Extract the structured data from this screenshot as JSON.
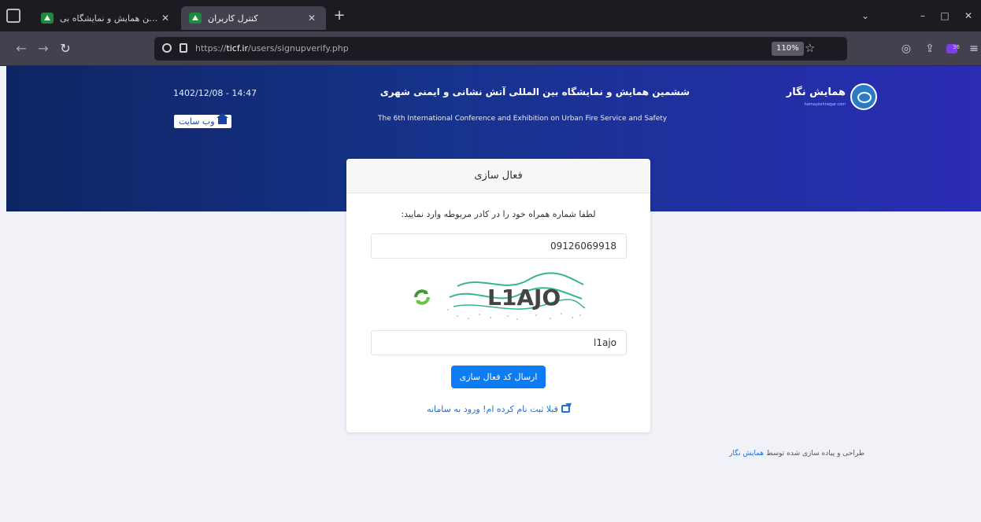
{
  "browser": {
    "tabs": [
      {
        "title": "ششمین همایش و نمایشگاه بی",
        "active": false
      },
      {
        "title": "کنترل کاربران",
        "active": true
      }
    ],
    "new_tab_label": "+",
    "url_prefix": "https://",
    "url_host": "ticf.ir",
    "url_path": "/users/signupverify.php",
    "zoom": "110%",
    "window_controls": {
      "minimize": "–",
      "maximize": "□",
      "close": "✕"
    },
    "toolbar_icons": [
      "pocket-icon",
      "share-icon",
      "extension-icon",
      "menu-icon"
    ],
    "extension_badge": "36"
  },
  "header": {
    "datetime": "1402/12/08 - 14:47",
    "website_button": "وب سایت",
    "title_fa": "ششمین همایش و نمایشگاه بین المللی آتش نشانی و ایمنی شهری",
    "title_en": "The 6th International Conference and Exhibition on Urban Fire Service and Safety",
    "logo_text": "همایش نگار",
    "logo_sub": "hamayeshnegar.com",
    "gradient": [
      "#0e2563",
      "#16338c",
      "#2a2cb4"
    ]
  },
  "card": {
    "title": "فعال سازی",
    "instruction": "لطفا شماره همراه خود را در کادر مربوطه وارد نمایید:",
    "phone_value": "09126069918",
    "captcha_image_text": "L1AJO",
    "captcha_value": "l1ajo",
    "submit_label": "ارسال کد فعال سازی",
    "login_link": "قبلا ثبت نام کرده ام! ورود به سامانه"
  },
  "footer": {
    "text": "طراحی و پیاده سازی شده توسط",
    "brand": "همایش نگار"
  },
  "colors": {
    "primary_button": "#0d7cf2",
    "link": "#1f6fd8",
    "page_background": "#f0f2f7",
    "refresh_green": "#3f9a2b"
  }
}
